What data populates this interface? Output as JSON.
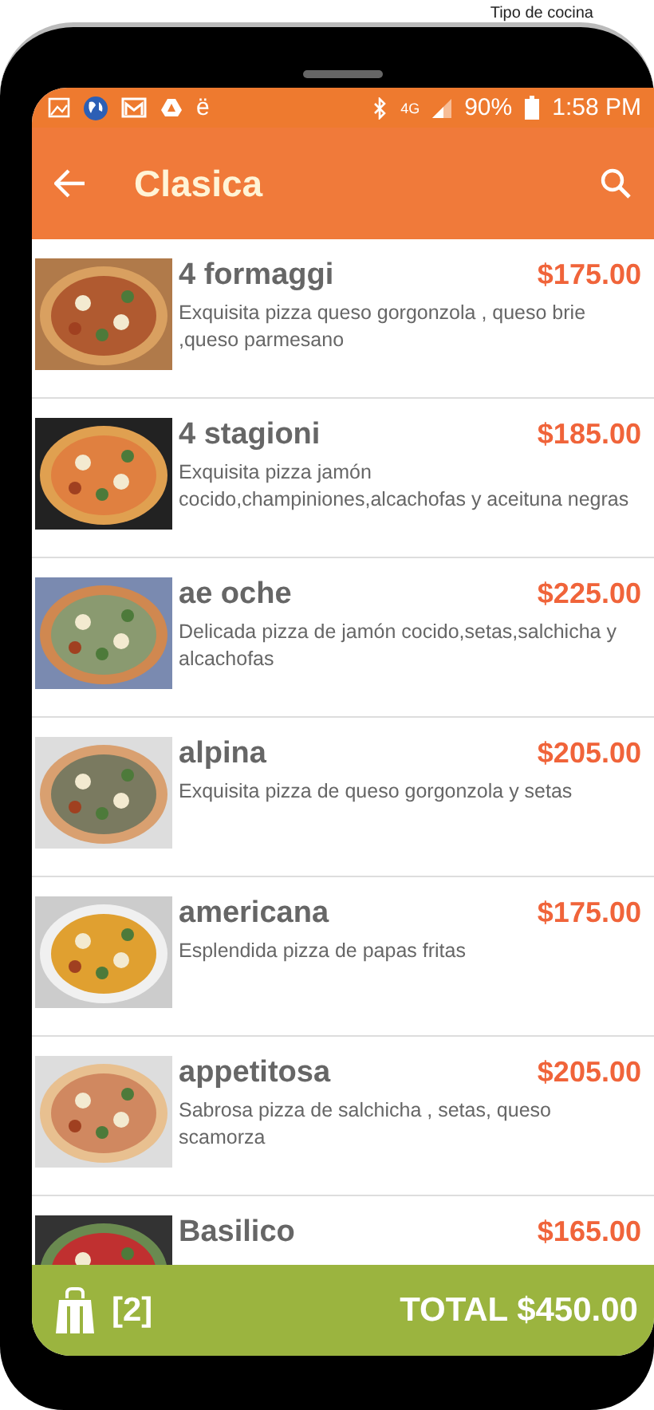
{
  "caption": "Tipo de cocina",
  "status_bar": {
    "app_glyph": "ë",
    "network": "4G",
    "battery": "90%",
    "time": "1:58 PM"
  },
  "app_bar": {
    "title": "Clasica"
  },
  "items": [
    {
      "name": "4 formaggi",
      "price": "$175.00",
      "description": "Exquisita pizza  queso gorgonzola , queso brie ,queso parmesano"
    },
    {
      "name": "4 stagioni",
      "price": "$185.00",
      "description": "Exquisita pizza  jamón cocido,champiniones,alcachofas y aceituna negras"
    },
    {
      "name": "ae oche",
      "price": "$225.00",
      "description": "Delicada pizza de jamón cocido,setas,salchicha y alcachofas"
    },
    {
      "name": "alpina",
      "price": "$205.00",
      "description": "Exquisita pizza de queso gorgonzola y setas"
    },
    {
      "name": "americana",
      "price": "$175.00",
      "description": "Esplendida pizza de papas fritas"
    },
    {
      "name": "appetitosa",
      "price": "$205.00",
      "description": "Sabrosa pizza de salchicha , setas, queso scamorza"
    },
    {
      "name": "Basilico",
      "price": "$165.00"
    }
  ],
  "cart": {
    "count": "[2]",
    "total": "TOTAL $450.00"
  }
}
